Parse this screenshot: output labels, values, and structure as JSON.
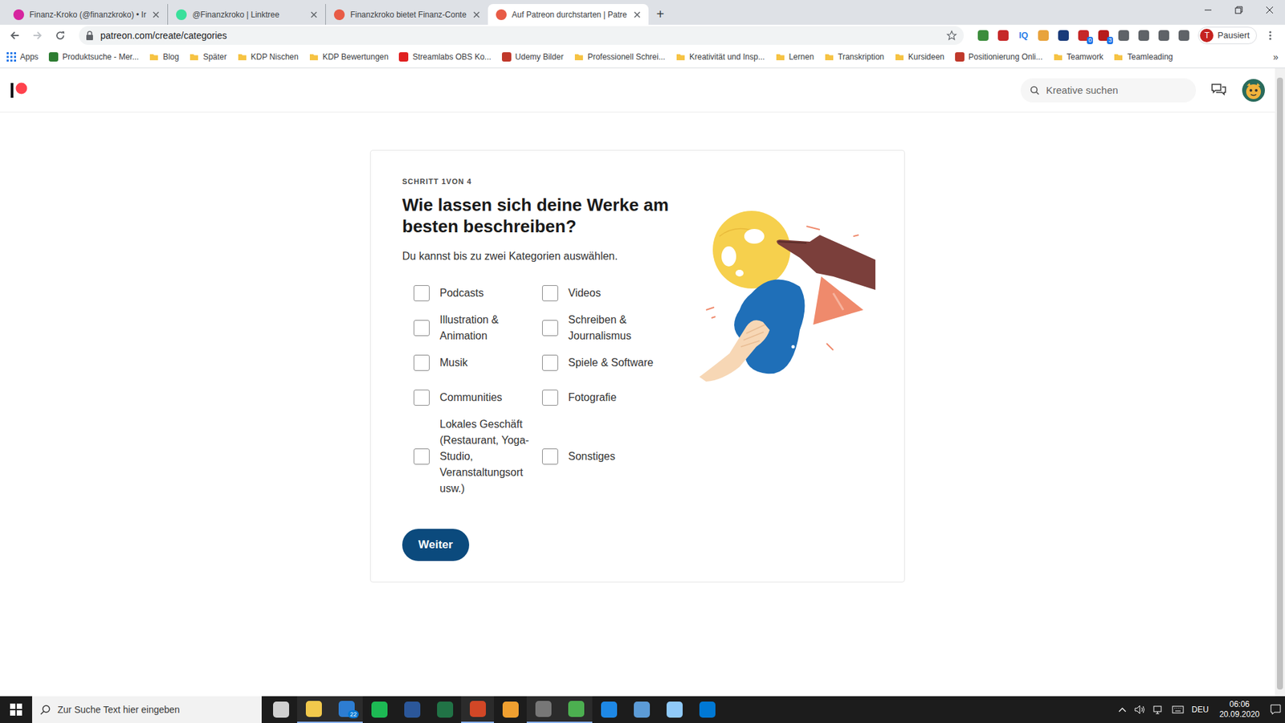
{
  "browser": {
    "tabs": [
      {
        "label": "Finanz-Kroko (@finanzkroko) • Ir",
        "selected": false,
        "color": "#d6249f"
      },
      {
        "label": "@Finanzkroko | Linktree",
        "selected": false,
        "color": "#39e09b"
      },
      {
        "label": "Finanzkroko bietet Finanz-Conte",
        "selected": false,
        "color": "#e85b46"
      },
      {
        "label": "Auf Patreon durchstarten | Patre",
        "selected": true,
        "color": "#e85b46"
      }
    ],
    "new_tab": "+",
    "address": "patreon.com/create/categories",
    "extensions": [
      {
        "kind": "icon",
        "color": "#3c8d3c"
      },
      {
        "kind": "icon",
        "color": "#c62828"
      },
      {
        "kind": "text",
        "text": "IQ",
        "color": "#2b7de9"
      },
      {
        "kind": "icon",
        "color": "#e8a33d"
      },
      {
        "kind": "icon",
        "color": "#1a3b7a"
      },
      {
        "kind": "icon",
        "color": "#c62828",
        "badge": "0"
      },
      {
        "kind": "icon",
        "color": "#b71c1c",
        "badge": "3"
      },
      {
        "kind": "icon",
        "color": "#5f6368"
      },
      {
        "kind": "icon",
        "color": "#5f6368"
      },
      {
        "kind": "icon",
        "color": "#5f6368"
      },
      {
        "kind": "icon",
        "color": "#5f6368"
      }
    ],
    "profile": {
      "initial": "T",
      "label": "Pausiert"
    },
    "bookmarks": [
      {
        "label": "Apps",
        "kind": "apps"
      },
      {
        "label": "Produktsuche - Mer...",
        "kind": "site",
        "color": "#2e7d32"
      },
      {
        "label": "Blog",
        "kind": "folder"
      },
      {
        "label": "Später",
        "kind": "folder"
      },
      {
        "label": "KDP Nischen",
        "kind": "folder"
      },
      {
        "label": "KDP Bewertungen",
        "kind": "folder"
      },
      {
        "label": "Streamlabs OBS Ko...",
        "kind": "site",
        "color": "#e02020"
      },
      {
        "label": "Udemy Bilder",
        "kind": "site",
        "color": "#c0392b"
      },
      {
        "label": "Professionell Schrei...",
        "kind": "folder"
      },
      {
        "label": "Kreativität und Insp...",
        "kind": "folder"
      },
      {
        "label": "Lernen",
        "kind": "folder"
      },
      {
        "label": "Transkription",
        "kind": "folder"
      },
      {
        "label": "Kursideen",
        "kind": "folder"
      },
      {
        "label": "Positionierung Onli...",
        "kind": "site",
        "color": "#c0392b"
      },
      {
        "label": "Teamwork",
        "kind": "folder"
      },
      {
        "label": "Teamleading",
        "kind": "folder"
      }
    ],
    "more_bookmarks": "»"
  },
  "page": {
    "search": {
      "placeholder": "Kreative suchen"
    },
    "card": {
      "step": "SCHRITT 1VON 4",
      "title": "Wie lassen sich deine Werke am besten beschreiben?",
      "hint": "Du kannst bis zu zwei Kategorien auswählen.",
      "columns": [
        [
          {
            "label": "Podcasts",
            "checked": false
          },
          {
            "label": "Illustration & Animation",
            "checked": false
          },
          {
            "label": "Musik",
            "checked": false
          },
          {
            "label": "Communities",
            "checked": false
          },
          {
            "label": "Lokales Geschäft (Restaurant, Yoga-Studio, Veranstaltungsort usw.)",
            "checked": false
          }
        ],
        [
          {
            "label": "Videos",
            "checked": false
          },
          {
            "label": "Schreiben & Journalismus",
            "checked": false
          },
          {
            "label": "Spiele & Software",
            "checked": false
          },
          {
            "label": "Fotografie",
            "checked": false
          },
          {
            "label": "Sonstiges",
            "checked": false
          }
        ]
      ],
      "button": "Weiter"
    }
  },
  "taskbar": {
    "search_placeholder": "Zur Suche Text hier eingeben",
    "apps": [
      {
        "color": "#d0d0d0",
        "active": false
      },
      {
        "color": "#f2c94c",
        "active": true
      },
      {
        "color": "#2d7dd2",
        "active": true,
        "badge": "22"
      },
      {
        "color": "#1db954",
        "active": false
      },
      {
        "color": "#2b579a",
        "active": false
      },
      {
        "color": "#217346",
        "active": false
      },
      {
        "color": "#d24726",
        "active": true
      },
      {
        "color": "#f0a030",
        "active": false
      },
      {
        "color": "#777777",
        "active": true
      },
      {
        "color": "#4caf50",
        "active": true
      },
      {
        "color": "#1e88e5",
        "active": false
      },
      {
        "color": "#5c9bd6",
        "active": false
      },
      {
        "color": "#90caf9",
        "active": false
      },
      {
        "color": "#0078d4",
        "active": false
      }
    ],
    "language": "DEU",
    "time": "06:06",
    "date": "20.09.2020"
  }
}
